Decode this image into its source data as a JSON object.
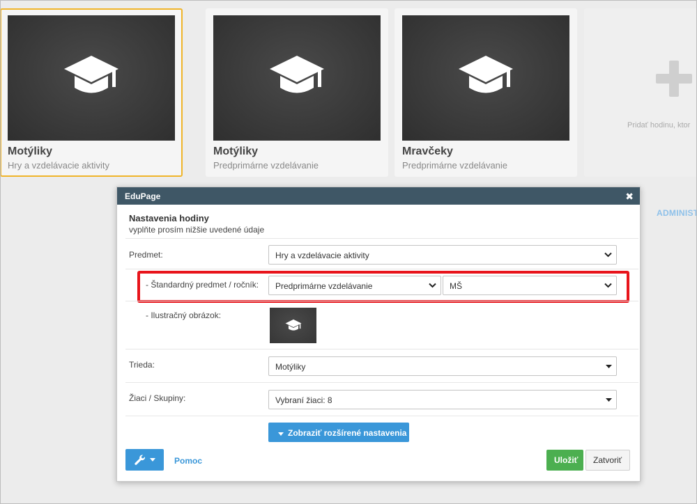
{
  "cards": [
    {
      "title": "Motýliky",
      "subtitle": "Hry a vzdelávacie aktivity"
    },
    {
      "title": "Motýliky",
      "subtitle": "Predprimárne vzdelávanie"
    },
    {
      "title": "Mravčeky",
      "subtitle": "Predprimárne vzdelávanie"
    }
  ],
  "add_card": {
    "text": "Pridať hodinu, ktor"
  },
  "admin_link": "ADMINIST",
  "dialog": {
    "header": "EduPage",
    "close_symbol": "✖",
    "heading": "Nastavenia hodiny",
    "subheading": "vyplňte prosím nižšie uvedené údaje",
    "subject_label": "Predmet:",
    "subject_value": "Hry a vzdelávacie aktivity",
    "standard_label": "- Štandardný predmet / ročník:",
    "standard_subject_value": "Predprimárne vzdelávanie",
    "grade_value": "MŠ",
    "image_label": "- Ilustračný obrázok:",
    "class_label": "Trieda:",
    "class_value": "Motýliky",
    "students_label": "Žiaci / Skupiny:",
    "students_value": "Vybraní žiaci: 8",
    "advanced_button": "Zobraziť rozšírené nastavenia",
    "help_link": "Pomoc",
    "save_button": "Uložiť",
    "close_button": "Zatvoriť"
  },
  "colors": {
    "accent": "#3a97d9",
    "save": "#4caf50",
    "header": "#3f5766",
    "highlight": "#e8141b",
    "selected_border": "#f0b429"
  },
  "icons": {
    "card_icon": "graduation-cap-icon",
    "add_icon": "plus-icon",
    "tools_icon": "wrench-icon"
  }
}
